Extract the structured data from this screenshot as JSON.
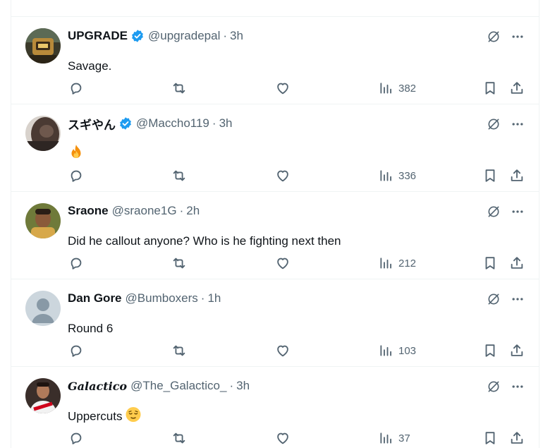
{
  "colors": {
    "verified": "#1d9bf0",
    "muted": "#536471",
    "border": "#eff3f4",
    "text": "#0f1419"
  },
  "icons": [
    "verified-badge-icon",
    "grok-icon",
    "more-icon",
    "reply-icon",
    "retweet-icon",
    "like-icon",
    "views-icon",
    "bookmark-icon",
    "share-icon"
  ],
  "tweets": [
    {
      "name": "UPGRADE",
      "verified": true,
      "handle": "@upgradepal",
      "time": "3h",
      "text": "Savage.",
      "emoji": "",
      "views": "382"
    },
    {
      "name": "スギやん",
      "verified": true,
      "handle": "@Maccho119",
      "time": "3h",
      "text": "",
      "emoji": "fire",
      "views": "336"
    },
    {
      "name": "Sraone",
      "verified": false,
      "handle": "@sraone1G",
      "time": "2h",
      "text": "Did he callout anyone? Who is he fighting next then",
      "emoji": "",
      "views": "212"
    },
    {
      "name": "Dan Gore",
      "verified": false,
      "handle": "@Bumboxers",
      "time": "1h",
      "text": "Round 6",
      "emoji": "",
      "views": "103"
    },
    {
      "name": "Galactico",
      "verified": false,
      "handle": "@The_Galactico_",
      "time": "3h",
      "text": "Uppercuts",
      "emoji": "relieved-face",
      "views": "37"
    }
  ]
}
